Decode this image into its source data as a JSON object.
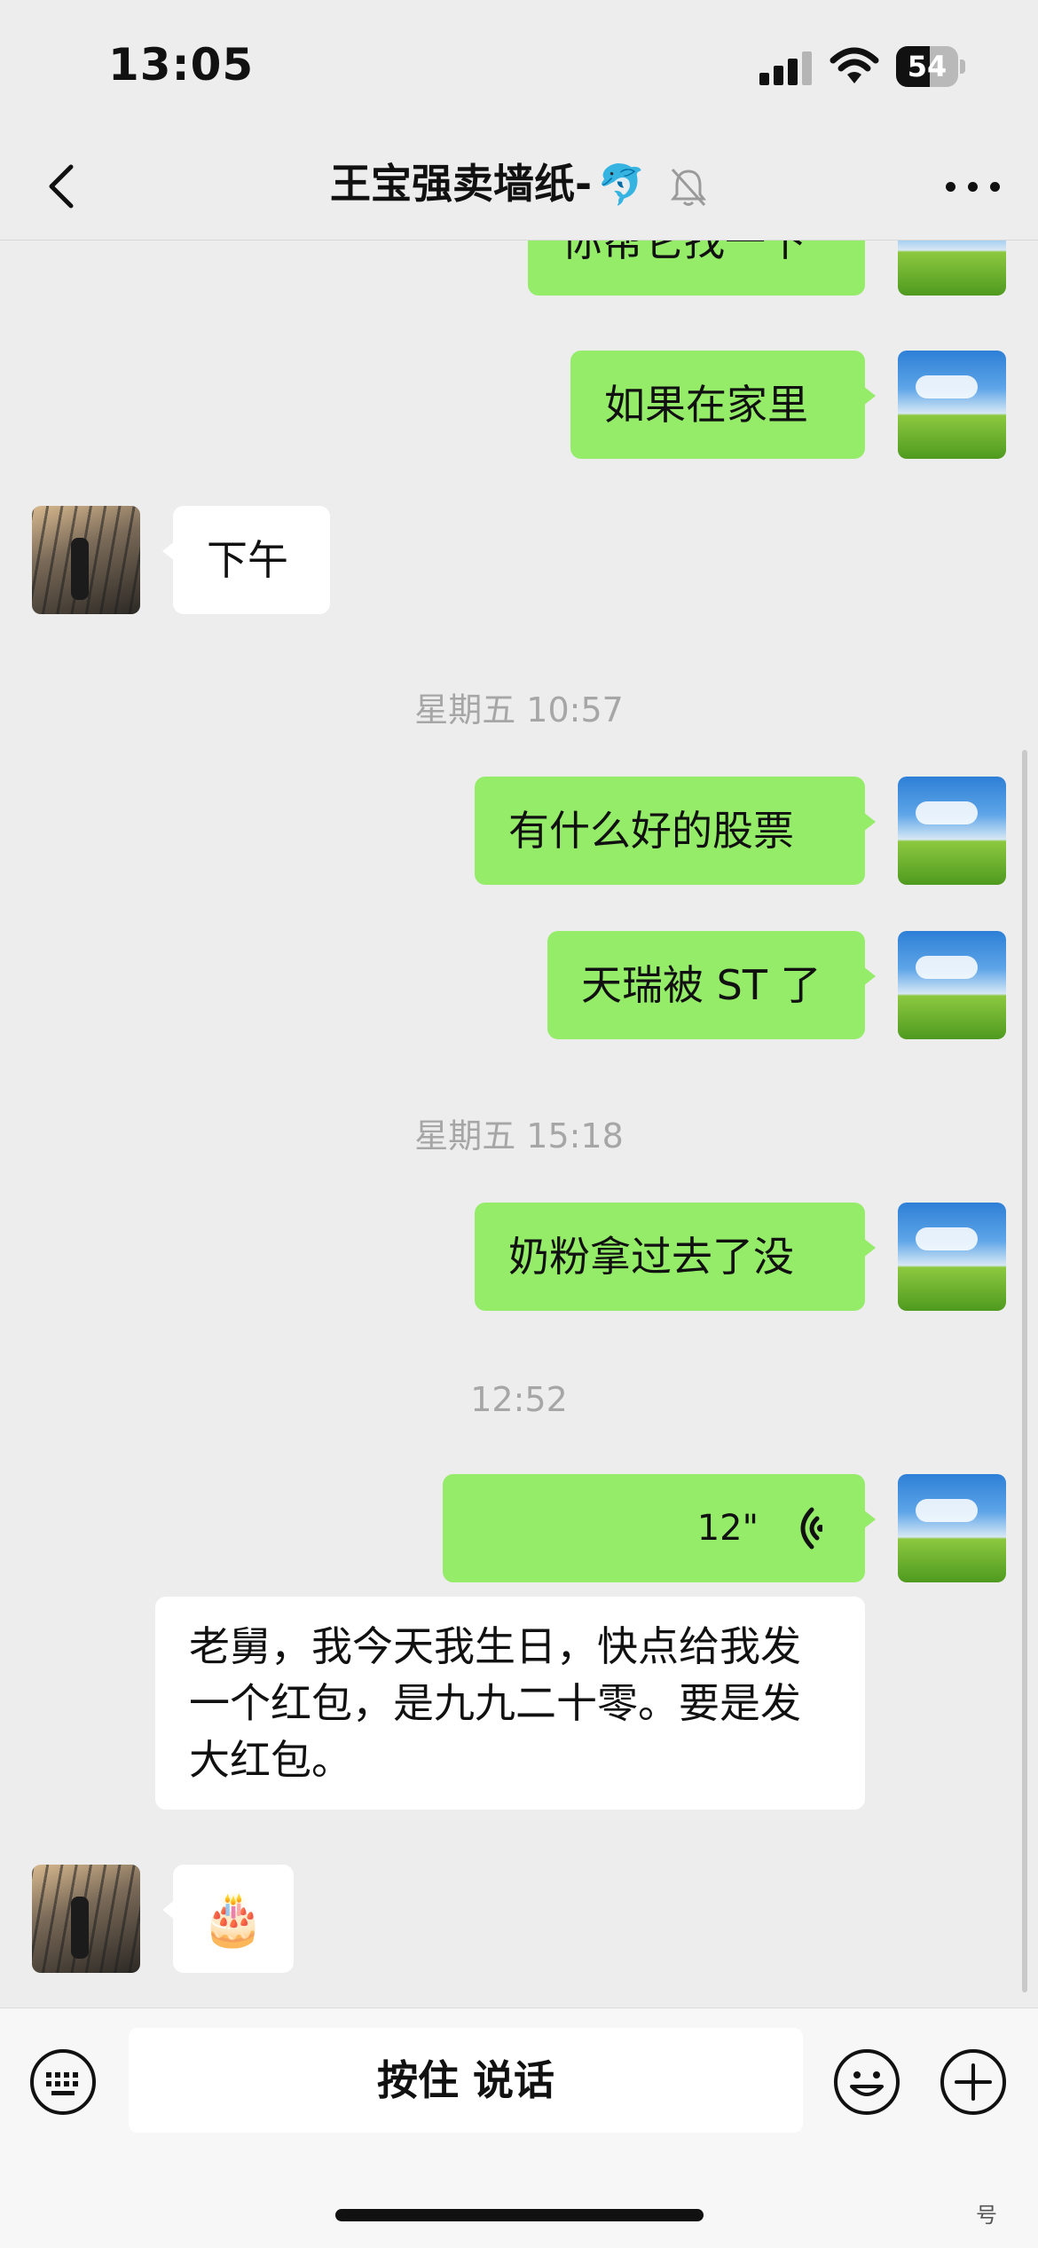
{
  "status_bar": {
    "time": "13:05",
    "battery": "54",
    "battery_level": 0.54
  },
  "nav": {
    "title": "王宝强卖墙纸-",
    "title_emoji": "🐬"
  },
  "messages": {
    "m1": "你帮它找一下",
    "m2": "如果在家里",
    "m3": "下午",
    "ts1": "星期五 10:57",
    "m4": "有什么好的股票",
    "m5": "天瑞被 ST 了",
    "ts2": "星期五 15:18",
    "m6": "奶粉拿过去了没",
    "ts3": "12:52",
    "voice_duration": "12\"",
    "transcript": "老舅，我今天我生日，快点给我发一个红包，是九九二十零。要是发大红包。",
    "cake": "🎂"
  },
  "input_bar": {
    "talk_label": "按住 说话"
  },
  "watermark": "号",
  "colors": {
    "mine_bubble": "#95ec69",
    "theirs_bubble": "#ffffff",
    "background": "#ededed"
  },
  "icons": [
    "back-chevron-icon",
    "mute-bell-icon",
    "more-icon",
    "voice-wave-icon",
    "keyboard-icon",
    "emoji-icon",
    "plus-icon"
  ]
}
